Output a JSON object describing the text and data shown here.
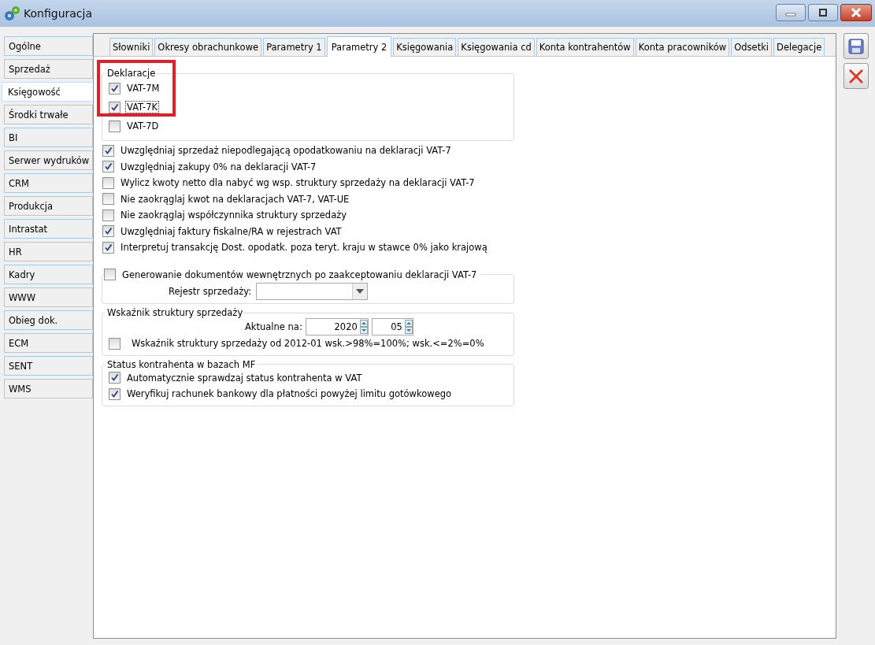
{
  "window": {
    "title": "Konfiguracja"
  },
  "sidebar": {
    "items": [
      {
        "label": "Ogólne",
        "selected": false
      },
      {
        "label": "Sprzedaż",
        "selected": false
      },
      {
        "label": "Księgowość",
        "selected": true
      },
      {
        "label": "Środki trwałe",
        "selected": false
      },
      {
        "label": "BI",
        "selected": false
      },
      {
        "label": "Serwer wydruków",
        "selected": false
      },
      {
        "label": "CRM",
        "selected": false
      },
      {
        "label": "Produkcja",
        "selected": false
      },
      {
        "label": "Intrastat",
        "selected": false
      },
      {
        "label": "HR",
        "selected": false
      },
      {
        "label": "Kadry",
        "selected": false
      },
      {
        "label": "WWW",
        "selected": false
      },
      {
        "label": "Obieg dok.",
        "selected": false
      },
      {
        "label": "ECM",
        "selected": false
      },
      {
        "label": "SENT",
        "selected": false
      },
      {
        "label": "WMS",
        "selected": false
      }
    ]
  },
  "tabs": [
    {
      "label": "Słowniki",
      "selected": false
    },
    {
      "label": "Okresy obrachunkowe",
      "selected": false
    },
    {
      "label": "Parametry 1",
      "selected": false
    },
    {
      "label": "Parametry 2",
      "selected": true
    },
    {
      "label": "Księgowania",
      "selected": false
    },
    {
      "label": "Księgowania cd",
      "selected": false
    },
    {
      "label": "Konta kontrahentów",
      "selected": false
    },
    {
      "label": "Konta pracowników",
      "selected": false
    },
    {
      "label": "Odsetki",
      "selected": false
    },
    {
      "label": "Delegacje",
      "selected": false
    }
  ],
  "declarations": {
    "title": "Deklaracje",
    "items": [
      {
        "label": "VAT-7M",
        "checked": true,
        "focused": false
      },
      {
        "label": "VAT-7K",
        "checked": true,
        "focused": true
      },
      {
        "label": "VAT-7D",
        "checked": false,
        "focused": false
      }
    ]
  },
  "options": [
    {
      "label": "Uwzględniaj sprzedaż niepodlegającą opodatkowaniu na deklaracji VAT-7",
      "checked": true
    },
    {
      "label": "Uwzględniaj zakupy 0% na deklaracji VAT-7",
      "checked": true
    },
    {
      "label": "Wylicz kwoty netto dla nabyć wg wsp. struktury sprzedaży na deklaracji VAT-7",
      "checked": false
    },
    {
      "label": "Nie zaokrąglaj kwot na deklaracjach VAT-7, VAT-UE",
      "checked": false
    },
    {
      "label": "Nie zaokrąglaj współczynnika struktury sprzedaży",
      "checked": false
    },
    {
      "label": "Uwzględniaj faktury fiskalne/RA w rejestrach VAT",
      "checked": true
    },
    {
      "label": "Interpretuj transakcję Dost. opodatk. poza teryt. kraju w stawce 0% jako krajową",
      "checked": true
    }
  ],
  "internal_docs": {
    "label": "Generowanie dokumentów wewnętrznych po zaakceptowaniu deklaracji VAT-7",
    "checked": false,
    "register_label": "Rejestr sprzedaży:"
  },
  "structure": {
    "title": "Wskaźnik struktury sprzedaży",
    "date_label": "Aktualne na:",
    "year": "2020",
    "month": "05",
    "option": {
      "label": "Wskaźnik struktury sprzedaży od 2012-01 wsk.>98%=100%; wsk.<=2%=0%",
      "checked": false
    }
  },
  "status": {
    "title": "Status kontrahenta w bazach MF",
    "items": [
      {
        "label": "Automatycznie sprawdzaj status kontrahenta w VAT",
        "checked": true
      },
      {
        "label": "Weryfikuj rachunek bankowy dla płatności powyżej limitu gotówkowego",
        "checked": true
      }
    ]
  }
}
